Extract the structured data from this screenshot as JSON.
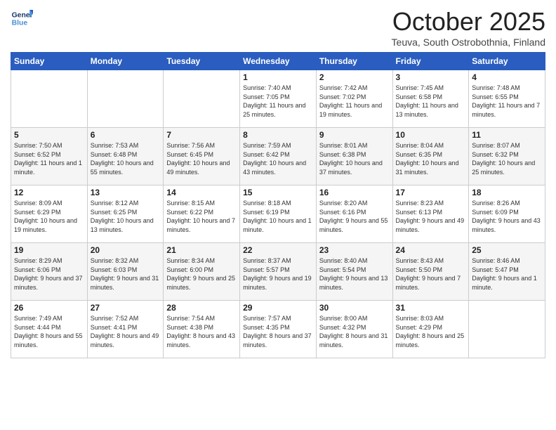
{
  "logo": {
    "line1": "General",
    "line2": "Blue"
  },
  "title": "October 2025",
  "subtitle": "Teuva, South Ostrobothnia, Finland",
  "days_of_week": [
    "Sunday",
    "Monday",
    "Tuesday",
    "Wednesday",
    "Thursday",
    "Friday",
    "Saturday"
  ],
  "weeks": [
    [
      {
        "day": "",
        "info": ""
      },
      {
        "day": "",
        "info": ""
      },
      {
        "day": "",
        "info": ""
      },
      {
        "day": "1",
        "info": "Sunrise: 7:40 AM\nSunset: 7:05 PM\nDaylight: 11 hours\nand 25 minutes."
      },
      {
        "day": "2",
        "info": "Sunrise: 7:42 AM\nSunset: 7:02 PM\nDaylight: 11 hours\nand 19 minutes."
      },
      {
        "day": "3",
        "info": "Sunrise: 7:45 AM\nSunset: 6:58 PM\nDaylight: 11 hours\nand 13 minutes."
      },
      {
        "day": "4",
        "info": "Sunrise: 7:48 AM\nSunset: 6:55 PM\nDaylight: 11 hours\nand 7 minutes."
      }
    ],
    [
      {
        "day": "5",
        "info": "Sunrise: 7:50 AM\nSunset: 6:52 PM\nDaylight: 11 hours\nand 1 minute."
      },
      {
        "day": "6",
        "info": "Sunrise: 7:53 AM\nSunset: 6:48 PM\nDaylight: 10 hours\nand 55 minutes."
      },
      {
        "day": "7",
        "info": "Sunrise: 7:56 AM\nSunset: 6:45 PM\nDaylight: 10 hours\nand 49 minutes."
      },
      {
        "day": "8",
        "info": "Sunrise: 7:59 AM\nSunset: 6:42 PM\nDaylight: 10 hours\nand 43 minutes."
      },
      {
        "day": "9",
        "info": "Sunrise: 8:01 AM\nSunset: 6:38 PM\nDaylight: 10 hours\nand 37 minutes."
      },
      {
        "day": "10",
        "info": "Sunrise: 8:04 AM\nSunset: 6:35 PM\nDaylight: 10 hours\nand 31 minutes."
      },
      {
        "day": "11",
        "info": "Sunrise: 8:07 AM\nSunset: 6:32 PM\nDaylight: 10 hours\nand 25 minutes."
      }
    ],
    [
      {
        "day": "12",
        "info": "Sunrise: 8:09 AM\nSunset: 6:29 PM\nDaylight: 10 hours\nand 19 minutes."
      },
      {
        "day": "13",
        "info": "Sunrise: 8:12 AM\nSunset: 6:25 PM\nDaylight: 10 hours\nand 13 minutes."
      },
      {
        "day": "14",
        "info": "Sunrise: 8:15 AM\nSunset: 6:22 PM\nDaylight: 10 hours\nand 7 minutes."
      },
      {
        "day": "15",
        "info": "Sunrise: 8:18 AM\nSunset: 6:19 PM\nDaylight: 10 hours\nand 1 minute."
      },
      {
        "day": "16",
        "info": "Sunrise: 8:20 AM\nSunset: 6:16 PM\nDaylight: 9 hours\nand 55 minutes."
      },
      {
        "day": "17",
        "info": "Sunrise: 8:23 AM\nSunset: 6:13 PM\nDaylight: 9 hours\nand 49 minutes."
      },
      {
        "day": "18",
        "info": "Sunrise: 8:26 AM\nSunset: 6:09 PM\nDaylight: 9 hours\nand 43 minutes."
      }
    ],
    [
      {
        "day": "19",
        "info": "Sunrise: 8:29 AM\nSunset: 6:06 PM\nDaylight: 9 hours\nand 37 minutes."
      },
      {
        "day": "20",
        "info": "Sunrise: 8:32 AM\nSunset: 6:03 PM\nDaylight: 9 hours\nand 31 minutes."
      },
      {
        "day": "21",
        "info": "Sunrise: 8:34 AM\nSunset: 6:00 PM\nDaylight: 9 hours\nand 25 minutes."
      },
      {
        "day": "22",
        "info": "Sunrise: 8:37 AM\nSunset: 5:57 PM\nDaylight: 9 hours\nand 19 minutes."
      },
      {
        "day": "23",
        "info": "Sunrise: 8:40 AM\nSunset: 5:54 PM\nDaylight: 9 hours\nand 13 minutes."
      },
      {
        "day": "24",
        "info": "Sunrise: 8:43 AM\nSunset: 5:50 PM\nDaylight: 9 hours\nand 7 minutes."
      },
      {
        "day": "25",
        "info": "Sunrise: 8:46 AM\nSunset: 5:47 PM\nDaylight: 9 hours\nand 1 minute."
      }
    ],
    [
      {
        "day": "26",
        "info": "Sunrise: 7:49 AM\nSunset: 4:44 PM\nDaylight: 8 hours\nand 55 minutes."
      },
      {
        "day": "27",
        "info": "Sunrise: 7:52 AM\nSunset: 4:41 PM\nDaylight: 8 hours\nand 49 minutes."
      },
      {
        "day": "28",
        "info": "Sunrise: 7:54 AM\nSunset: 4:38 PM\nDaylight: 8 hours\nand 43 minutes."
      },
      {
        "day": "29",
        "info": "Sunrise: 7:57 AM\nSunset: 4:35 PM\nDaylight: 8 hours\nand 37 minutes."
      },
      {
        "day": "30",
        "info": "Sunrise: 8:00 AM\nSunset: 4:32 PM\nDaylight: 8 hours\nand 31 minutes."
      },
      {
        "day": "31",
        "info": "Sunrise: 8:03 AM\nSunset: 4:29 PM\nDaylight: 8 hours\nand 25 minutes."
      },
      {
        "day": "",
        "info": ""
      }
    ]
  ]
}
